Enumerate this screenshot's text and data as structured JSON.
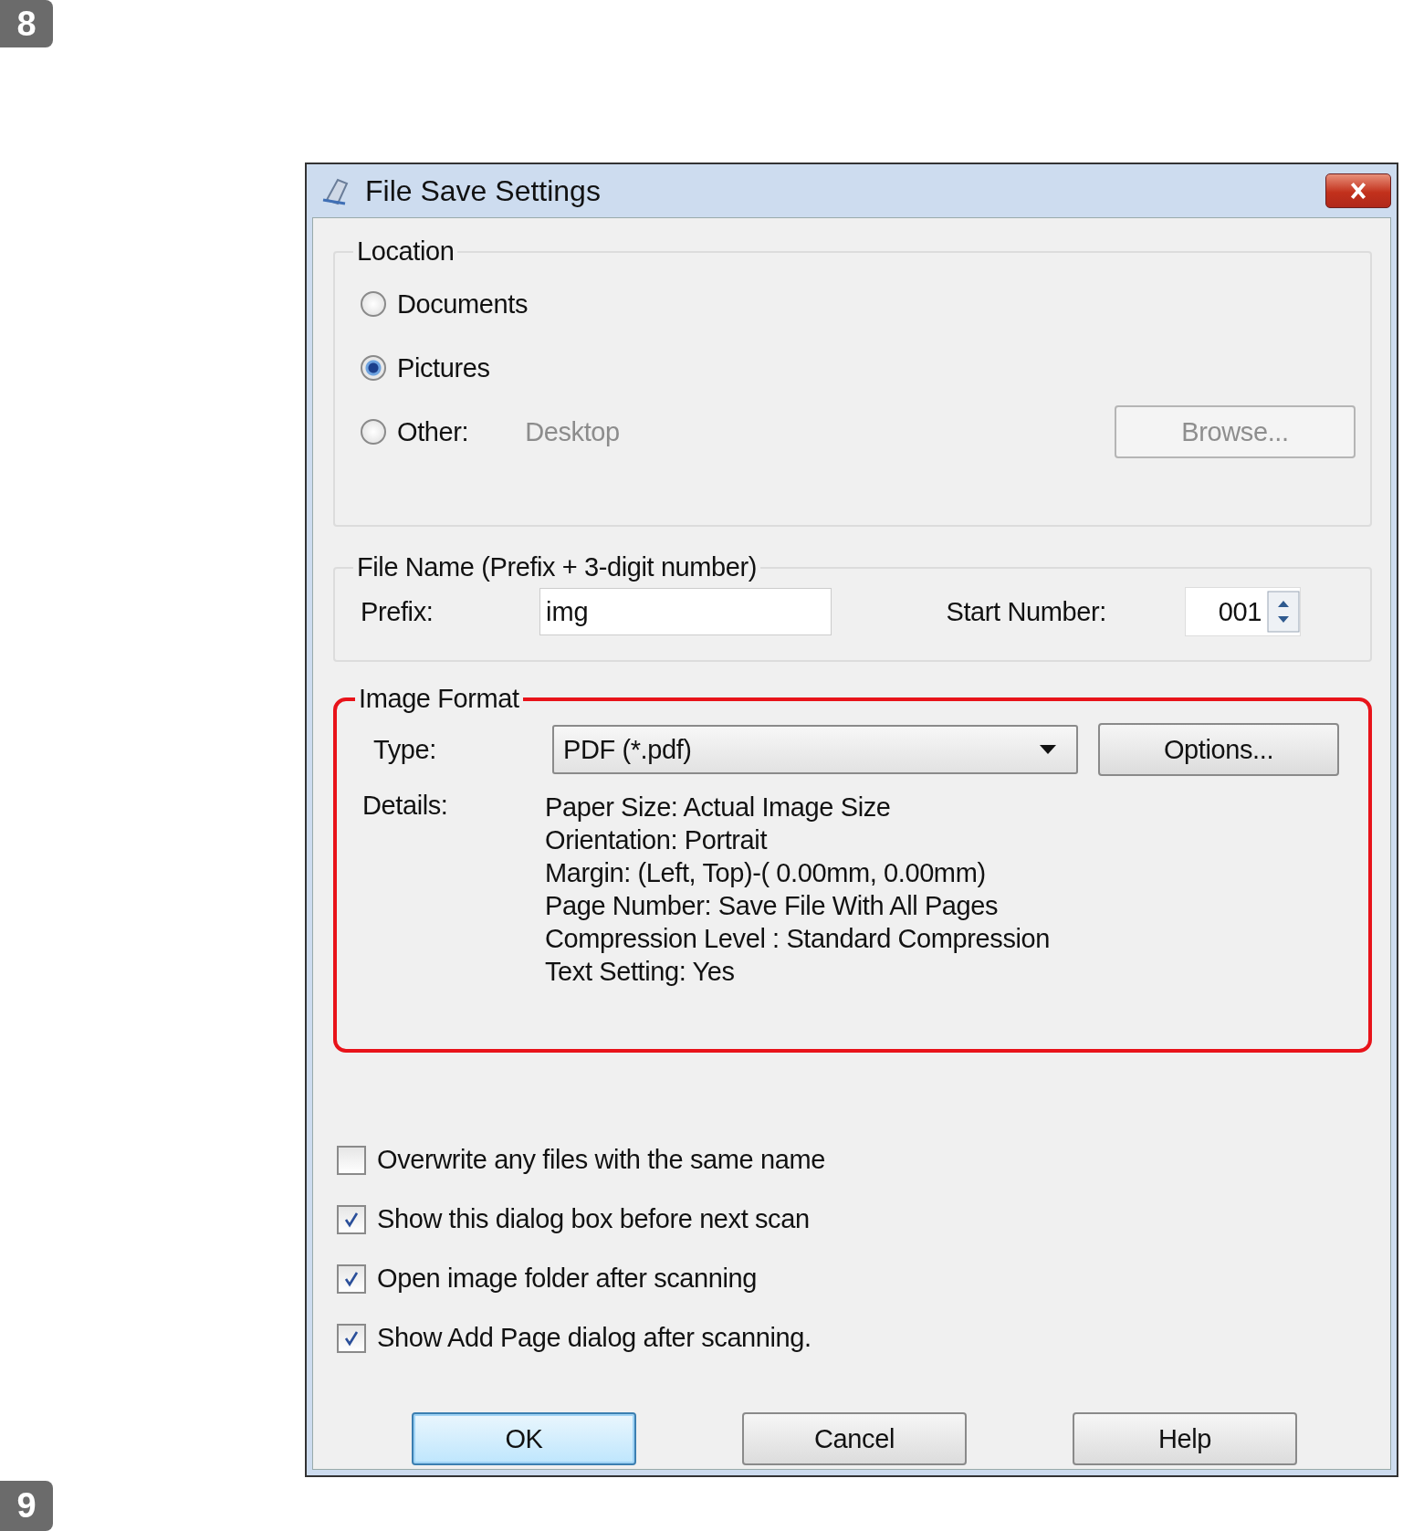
{
  "page_markers": [
    "8",
    "9"
  ],
  "window": {
    "title": "File Save Settings"
  },
  "location": {
    "title": "Location",
    "options": [
      {
        "label": "Documents",
        "selected": false
      },
      {
        "label": "Pictures",
        "selected": true
      },
      {
        "label": "Other:",
        "selected": false,
        "value": "Desktop"
      }
    ],
    "browse_button": {
      "label": "Browse...",
      "disabled": true
    }
  },
  "file_name": {
    "title": "File Name (Prefix + 3-digit number)",
    "prefix_label": "Prefix:",
    "prefix_value": "img",
    "start_label": "Start Number:",
    "start_value": "001"
  },
  "image_format": {
    "title": "Image Format",
    "highlighted": true,
    "type_label": "Type:",
    "type_value": "PDF (*.pdf)",
    "options_button": "Options...",
    "details_label": "Details:",
    "details": [
      "Paper Size: Actual Image Size",
      "Orientation: Portrait",
      "Margin: (Left, Top)-( 0.00mm, 0.00mm)",
      "Page Number: Save File With All Pages",
      "Compression Level : Standard Compression",
      "Text Setting: Yes"
    ]
  },
  "checkboxes": [
    {
      "label": "Overwrite any files with the same name",
      "checked": false
    },
    {
      "label": "Show this dialog box before next scan",
      "checked": true
    },
    {
      "label": "Open image folder after scanning",
      "checked": true
    },
    {
      "label": "Show Add Page dialog after scanning.",
      "checked": true
    }
  ],
  "buttons": [
    {
      "label": "OK",
      "default": true
    },
    {
      "label": "Cancel",
      "default": false
    },
    {
      "label": "Help",
      "default": false
    }
  ]
}
